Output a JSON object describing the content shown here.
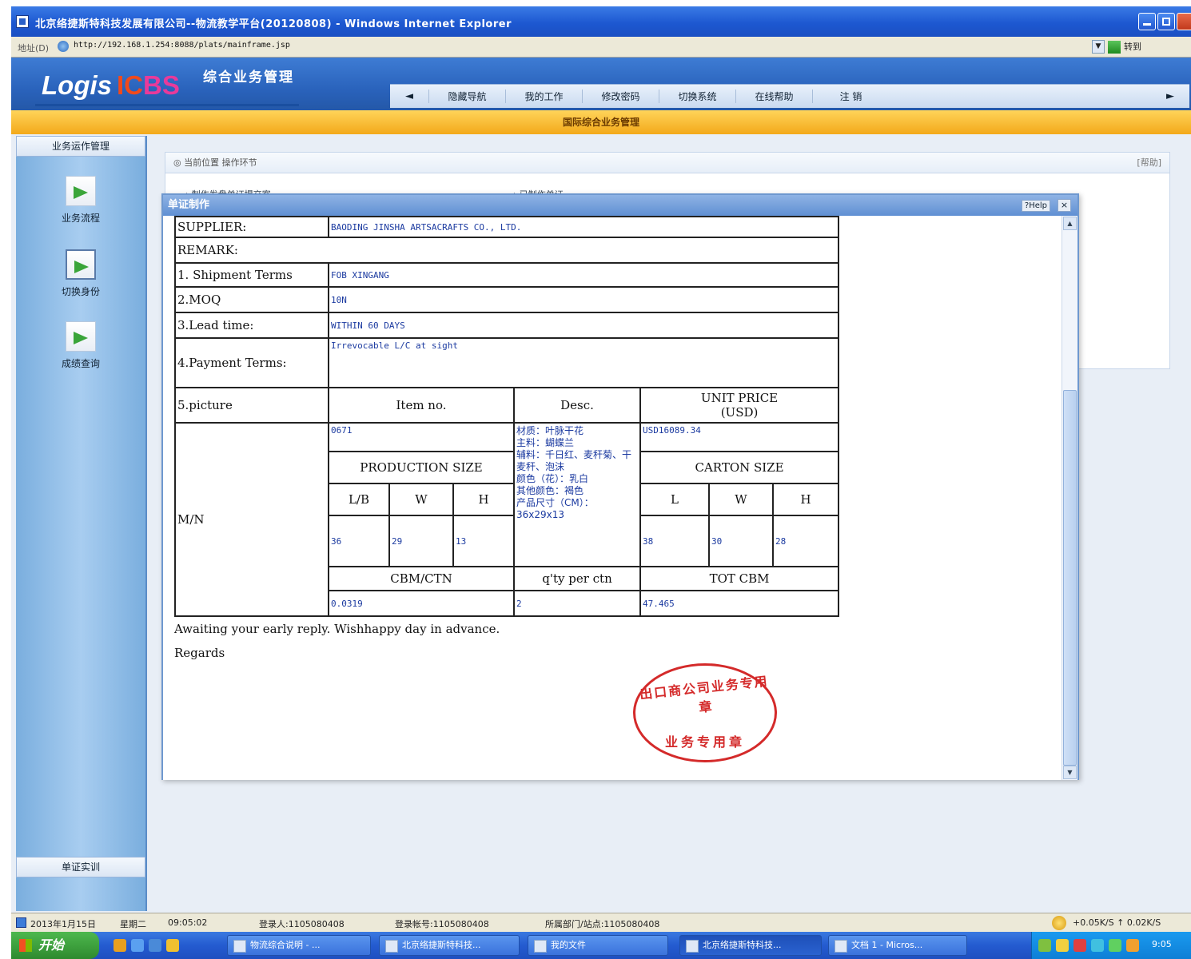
{
  "window": {
    "title": "北京络捷斯特科技发展有限公司--物流教学平台(20120808) - Windows Internet Explorer"
  },
  "addressbar": {
    "label": "地址(D)",
    "url": "http://192.168.1.254:8088/plats/mainframe.jsp",
    "go_label": "转到"
  },
  "app": {
    "logo_text": "Logis",
    "logo_ic": "IC",
    "logo_bs": "BS",
    "subtitle": "综合业务管理",
    "nav": [
      "隐藏导航",
      "我的工作",
      "修改密码",
      "切换系统",
      "在线帮助",
      "注  销"
    ],
    "band_title": "国际综合业务管理"
  },
  "sidebar": {
    "header": "业务运作管理",
    "items": [
      {
        "label": "业务流程",
        "icon": "arrow-doc-icon"
      },
      {
        "label": "切换身份",
        "icon": "arrow-doc-icon"
      },
      {
        "label": "成绩查询",
        "icon": "arrow-doc-icon"
      }
    ],
    "footer": "单证实训"
  },
  "background_panel": {
    "breadcrumb": "◎ 当前位置 操作环节",
    "tip": "[帮助]",
    "row_left": "→ 制作发盘单证提交客",
    "row_right": "→ 已制作单证"
  },
  "dialog": {
    "title": "单证制作",
    "help_label": "?Help",
    "close_label": "×"
  },
  "document": {
    "supplier_label": "SUPPLIER:",
    "supplier_value": "BAODING JINSHA ARTSACRAFTS CO., LTD.",
    "remark_label": "REMARK:",
    "shipment_label": "1. Shipment Terms",
    "shipment_value": "FOB XINGANG",
    "moq_label": "2.MOQ",
    "moq_value": "10N",
    "lead_label": "3.Lead time:",
    "lead_value": "WITHIN 60 DAYS",
    "payment_label": "4.Payment Terms:",
    "payment_value": "Irrevocable L/C at sight",
    "picture_label": "5.picture",
    "col_item": "Item no.",
    "col_desc": "Desc.",
    "col_unit_price": "UNIT PRICE",
    "col_unit_price_cur": "(USD)",
    "mn_label": "M/N",
    "item_no": "0671",
    "desc_text": "材质：叶脉干花\n主料：蝴蝶兰\n辅料：千日红、麦秆菊、干麦秆、泡沫\n颜色（花）：乳白\n其他颜色：褐色\n产品尺寸（CM）：\n36x29x13",
    "unit_price": "USD16089.34",
    "production_size": "PRODUCTION SIZE",
    "carton_size": "CARTON SIZE",
    "dim_l_b": "L/B",
    "dim_w": "W",
    "dim_h": "H",
    "dim_l": "L",
    "prod_l": "36",
    "prod_w": "29",
    "prod_h": "13",
    "carton_l": "38",
    "carton_w": "30",
    "carton_h": "28",
    "cbm_ctn_label": "CBM/CTN",
    "qty_per_ctn_label": "q'ty per ctn",
    "tot_cbm_label": "TOT CBM",
    "cbm_ctn": "0.0319",
    "qty_per_ctn": "2",
    "tot_cbm": "47.465",
    "closing": "Awaiting your early reply. Wishhappy day in advance.",
    "regards": "Regards"
  },
  "stamp": {
    "top_text": "出口商公司业务专用章",
    "bottom_text": "业务专用章"
  },
  "statusbar": {
    "date": "2013年1月15日",
    "weekday": "星期二",
    "time": "09:05:02",
    "login_user": "登录人:1105080408",
    "login_account": "登录帐号:1105080408",
    "department": "所属部门/站点:1105080408",
    "net_speed": "+0.05K/S ↑ 0.02K/S"
  },
  "taskbar": {
    "start_label": "开始",
    "tasks": [
      "物流综合说明 - ...",
      "北京络捷斯特科技...",
      "我的文件",
      "北京络捷斯特科技...",
      "文档 1 - Micros..."
    ],
    "clock": "9:05"
  }
}
